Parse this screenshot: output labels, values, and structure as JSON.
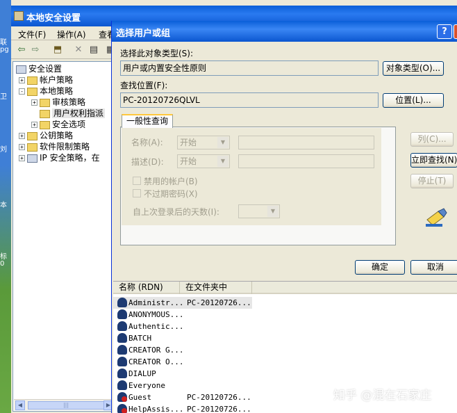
{
  "desktop": {
    "labels": [
      "联",
      "pg",
      "卫",
      "刘",
      "本",
      "标",
      "0"
    ]
  },
  "main_window": {
    "title": "本地安全设置",
    "menus": [
      "文件(F)",
      "操作(A)",
      "查看"
    ],
    "toolbar_icons": [
      "back-arrow-icon",
      "forward-arrow-icon",
      "up-folder-icon",
      "delete-icon",
      "properties-icon",
      "export-icon"
    ]
  },
  "tree": {
    "items": [
      {
        "label": "安全设置",
        "toggle": ""
      },
      {
        "label": "帐户策略",
        "toggle": "+"
      },
      {
        "label": "本地策略",
        "toggle": "-"
      },
      {
        "label": "审核策略",
        "toggle": "+"
      },
      {
        "label": "用户权利指派",
        "toggle": ""
      },
      {
        "label": "安全选项",
        "toggle": "+"
      },
      {
        "label": "公钥策略",
        "toggle": "+"
      },
      {
        "label": "软件限制策略",
        "toggle": "+"
      },
      {
        "label": "IP 安全策略，在 ",
        "toggle": "+"
      }
    ],
    "scroll_thumb": "|||"
  },
  "dialog": {
    "title": "选择用户或组",
    "help_btn": "?",
    "object_type_label": "选择此对象类型(S):",
    "object_type_value": "用户或内置安全性原则",
    "object_types_btn": "对象类型(O)...",
    "location_label": "查找位置(F):",
    "location_value": "PC-20120726QLVL",
    "location_btn": "位置(L)...",
    "tab_label": "一般性查询",
    "name_label": "名称(A):",
    "name_mode": "开始",
    "desc_label": "描述(D):",
    "desc_mode": "开始",
    "disabled_accounts": "禁用的帐户(B)",
    "no_expire_pwd": "不过期密码(X)",
    "days_since_logon": "自上次登录后的天数(I):",
    "columns_btn": "列(C)...",
    "find_now_btn": "立即查找(N)",
    "stop_btn": "停止(T)",
    "ok_btn": "确定",
    "cancel_btn": "取消",
    "results": {
      "headers": [
        "名称 (RDN)",
        "在文件夹中"
      ],
      "rows": [
        {
          "name": "Administr...",
          "folder": "PC-20120726...",
          "icon": "user-icon"
        },
        {
          "name": "ANONYMOUS...",
          "folder": "",
          "icon": "group-icon"
        },
        {
          "name": "Authentic...",
          "folder": "",
          "icon": "group-icon"
        },
        {
          "name": "BATCH",
          "folder": "",
          "icon": "group-icon"
        },
        {
          "name": "CREATOR G...",
          "folder": "",
          "icon": "group-icon"
        },
        {
          "name": "CREATOR O...",
          "folder": "",
          "icon": "group-icon"
        },
        {
          "name": "DIALUP",
          "folder": "",
          "icon": "group-icon"
        },
        {
          "name": "Everyone",
          "folder": "",
          "icon": "group-icon"
        },
        {
          "name": "Guest",
          "folder": "PC-20120726...",
          "icon": "disabled-user-icon"
        },
        {
          "name": "HelpAssis...",
          "folder": "PC-20120726...",
          "icon": "disabled-user-icon"
        }
      ]
    }
  },
  "watermark": "知乎 @混在石家庄"
}
